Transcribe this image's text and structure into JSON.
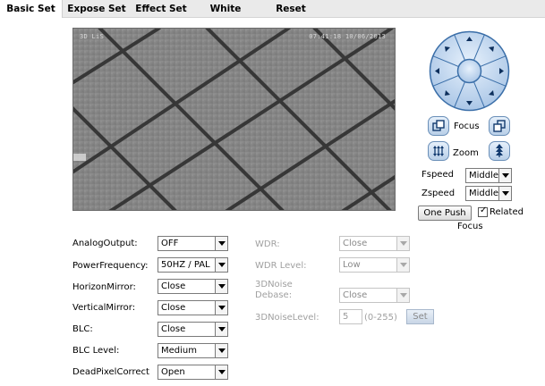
{
  "tabs": [
    {
      "label": "Basic Set"
    },
    {
      "label": "Expose Set"
    },
    {
      "label": "Effect Set"
    },
    {
      "label": "White"
    },
    {
      "label": "Reset"
    }
  ],
  "video": {
    "osd_left": "3D LiS",
    "osd_right": "07:41:18 10/06/2013"
  },
  "lens": {
    "focus_label": "Focus",
    "zoom_label": "Zoom"
  },
  "speed": {
    "fspeed_label": "Fspeed",
    "fspeed_value": "Middle",
    "zspeed_label": "Zspeed",
    "zspeed_value": "Middle"
  },
  "focus_controls": {
    "one_push_label": "One Push",
    "related_label": "Related",
    "related_checked": true,
    "focus_caption": "Focus"
  },
  "settings_left": [
    {
      "label": "AnalogOutput:",
      "value": "OFF"
    },
    {
      "label": "PowerFrequency:",
      "value": "50HZ / PAL"
    },
    {
      "label": "HorizonMirror:",
      "value": "Close"
    },
    {
      "label": "VerticalMirror:",
      "value": "Close"
    },
    {
      "label": "BLC:",
      "value": "Close"
    },
    {
      "label": "BLC Level:",
      "value": "Medium"
    },
    {
      "label": "DeadPixelCorrect",
      "value": "Open"
    }
  ],
  "settings_right": {
    "wdr_label": "WDR:",
    "wdr_value": "Close",
    "wdr_level_label": "WDR Level:",
    "wdr_level_value": "Low",
    "noise_debase_label_1": "3DNoise",
    "noise_debase_label_2": "Debase:",
    "noise_debase_value": "Close",
    "noise_level_label": "3DNoiseLevel:",
    "noise_level_value": "5",
    "noise_level_range": "(0-255)",
    "set_label": "Set"
  }
}
